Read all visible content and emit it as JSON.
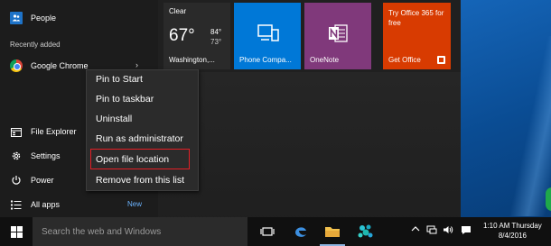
{
  "start_menu": {
    "top_items": [
      {
        "label": "People",
        "icon": "people-icon"
      }
    ],
    "recently_added_label": "Recently added",
    "recent_app": {
      "label": "Google Chrome",
      "icon": "chrome-icon",
      "arrow": "›"
    },
    "bottom_items": [
      {
        "label": "File Explorer",
        "icon": "file-explorer-icon"
      },
      {
        "label": "Settings",
        "icon": "gear-icon"
      },
      {
        "label": "Power",
        "icon": "power-icon"
      },
      {
        "label": "All apps",
        "icon": "all-apps-icon"
      }
    ],
    "new_badge": "New"
  },
  "tiles": {
    "weather": {
      "condition": "Clear",
      "temp": "67°",
      "high": "84°",
      "low": "73°",
      "label": "Washington,..."
    },
    "phone": {
      "label": "Phone Compa..."
    },
    "onenote": {
      "label": "OneNote"
    },
    "office": {
      "title": "Try Office 365 for free",
      "label": "Get Office"
    }
  },
  "context_menu": {
    "items": [
      "Pin to Start",
      "Pin to taskbar",
      "Uninstall",
      "Run as administrator",
      "Open file location",
      "Remove from this list"
    ],
    "highlighted": "Open file location",
    "highlight_color": "#e51e25"
  },
  "taskbar": {
    "search_placeholder": "Search the web and Windows",
    "pinned": [
      "task-view-icon",
      "edge-icon",
      "file-explorer-icon",
      "store-app-icon"
    ],
    "tray_icons": [
      "chevron-up-icon",
      "network-icon",
      "volume-icon",
      "action-center-icon"
    ],
    "clock_time": "1:10 AM Thursday",
    "clock_date": "8/4/2016"
  },
  "colors": {
    "phone_tile": "#0078d7",
    "onenote_tile": "#80397b",
    "office_tile": "#d83b01",
    "accent_link": "#6cb4ff"
  }
}
